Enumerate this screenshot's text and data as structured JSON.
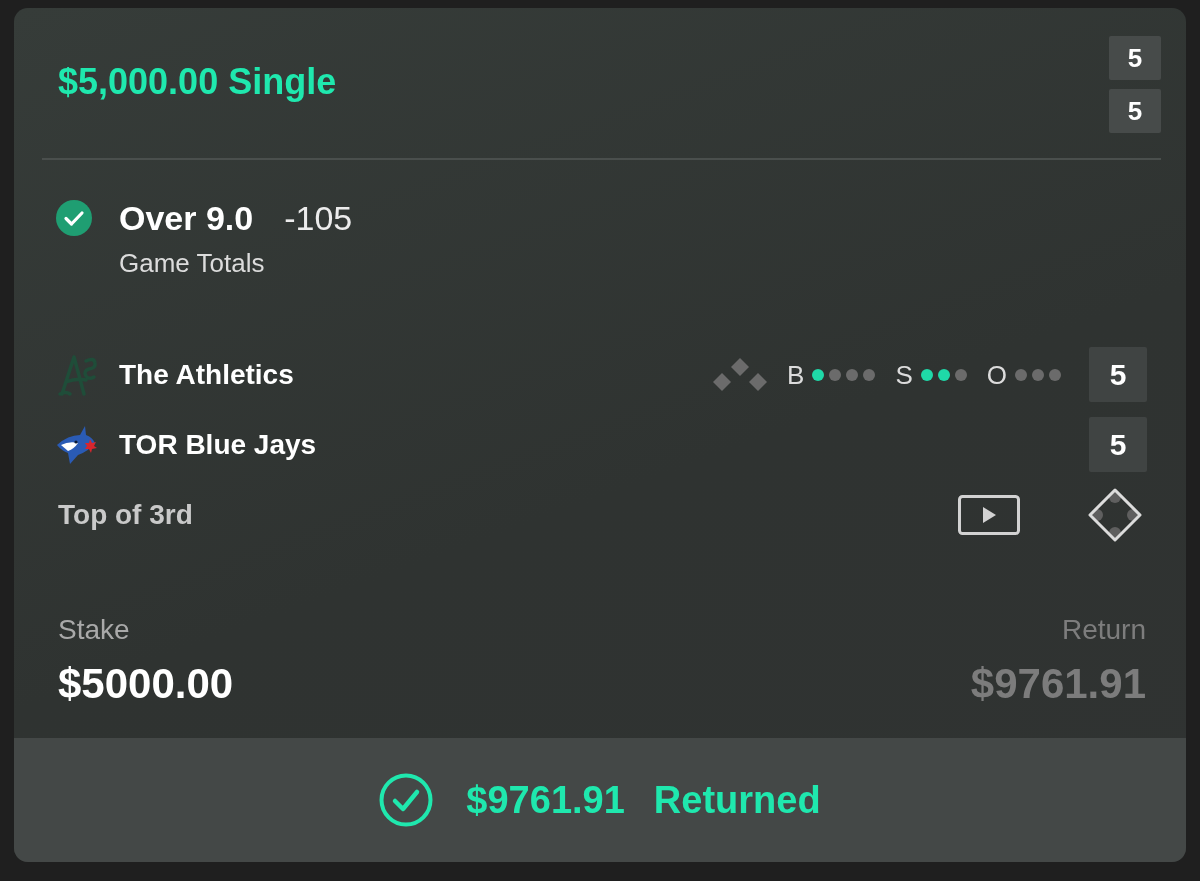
{
  "bet": {
    "title": "$5,000.00 Single",
    "scores": [
      "5",
      "5"
    ]
  },
  "selection": {
    "won": true,
    "pick": "Over 9.0",
    "odds": "-105",
    "market": "Game Totals"
  },
  "game": {
    "teams": [
      {
        "kind": "script",
        "name": "The Athletics",
        "score": "5"
      },
      {
        "kind": "bird",
        "name": "TOR Blue Jays",
        "score": "5"
      }
    ],
    "bases": [
      {
        "occupied": false
      },
      {
        "occupied": false
      },
      {
        "occupied": false
      }
    ],
    "count": [
      {
        "label": "B",
        "dots": [
          {
            "on": true
          },
          {
            "on": false
          },
          {
            "on": false
          },
          {
            "on": false
          }
        ]
      },
      {
        "label": "S",
        "dots": [
          {
            "on": true
          },
          {
            "on": true
          },
          {
            "on": false
          }
        ]
      },
      {
        "label": "O",
        "dots": [
          {
            "on": false
          },
          {
            "on": false
          },
          {
            "on": false
          }
        ]
      }
    ],
    "inning": "Top of 3rd"
  },
  "stake": {
    "label": "Stake",
    "amount": "$5000.00"
  },
  "return": {
    "label": "Return",
    "amount": "$9761.91"
  },
  "result": {
    "settled": true,
    "amount": "$9761.91",
    "status": "Returned"
  }
}
